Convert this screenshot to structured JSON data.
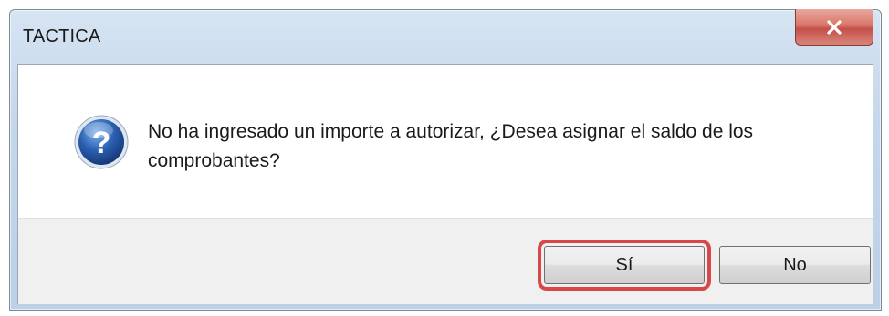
{
  "window": {
    "title": "TACTICA",
    "close_glyph": "x",
    "close_icon": "close-icon"
  },
  "dialog": {
    "icon": "question-icon",
    "message": "No ha ingresado un importe a autorizar, ¿Desea asignar el saldo de los comprobantes?"
  },
  "buttons": {
    "yes_label": "Sí",
    "no_label": "No",
    "highlight_color": "#d9474a"
  },
  "colors": {
    "close_button": "#c4504a",
    "icon_blue": "#2a5fb0"
  }
}
